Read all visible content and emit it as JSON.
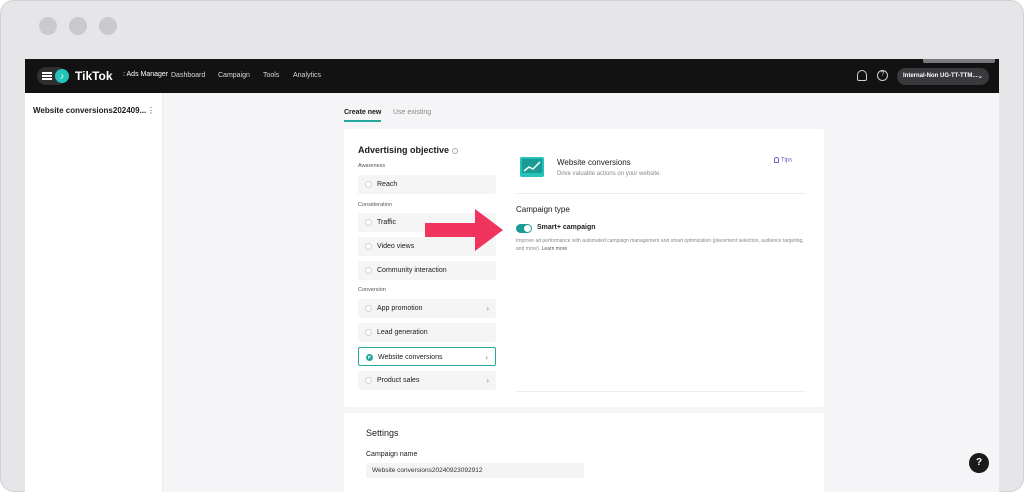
{
  "app": {
    "brand": "TikTok",
    "brand_sub": ": Ads Manager",
    "nav": [
      "Dashboard",
      "Campaign",
      "Tools",
      "Analytics"
    ],
    "account": "Internal-Non UG-TT-TTM..."
  },
  "sidebar": {
    "item_label": "Website conversions202409...",
    "more_label": "⋮"
  },
  "tabs": {
    "create_new": "Create new",
    "use_existing": "Use existing"
  },
  "objective": {
    "title": "Advertising objective",
    "groups": {
      "awareness": "Awareness",
      "consideration": "Consideration",
      "conversion": "Conversion"
    },
    "options": {
      "reach": "Reach",
      "traffic": "Traffic",
      "video_views": "Video views",
      "community_interaction": "Community interaction",
      "app_promotion": "App promotion",
      "lead_generation": "Lead generation",
      "website_conversions": "Website conversions",
      "product_sales": "Product sales"
    },
    "selected": "website_conversions"
  },
  "detail": {
    "title": "Website conversions",
    "desc": "Drive valuable actions on your website.",
    "tips": "Tips",
    "campaign_type_title": "Campaign type",
    "smart_label": "Smart+ campaign",
    "smart_enabled": true,
    "smart_desc": "Improve ad performance with automated campaign management and smart optimization (placement selection, audience targeting, and more).",
    "learn_more": "Learn more"
  },
  "settings": {
    "title": "Settings",
    "campaign_name_label": "Campaign name",
    "campaign_name_value": "Website conversions20240923092912"
  },
  "colors": {
    "accent": "#25a89d",
    "arrow": "#f0345e",
    "topbar": "#121212"
  }
}
